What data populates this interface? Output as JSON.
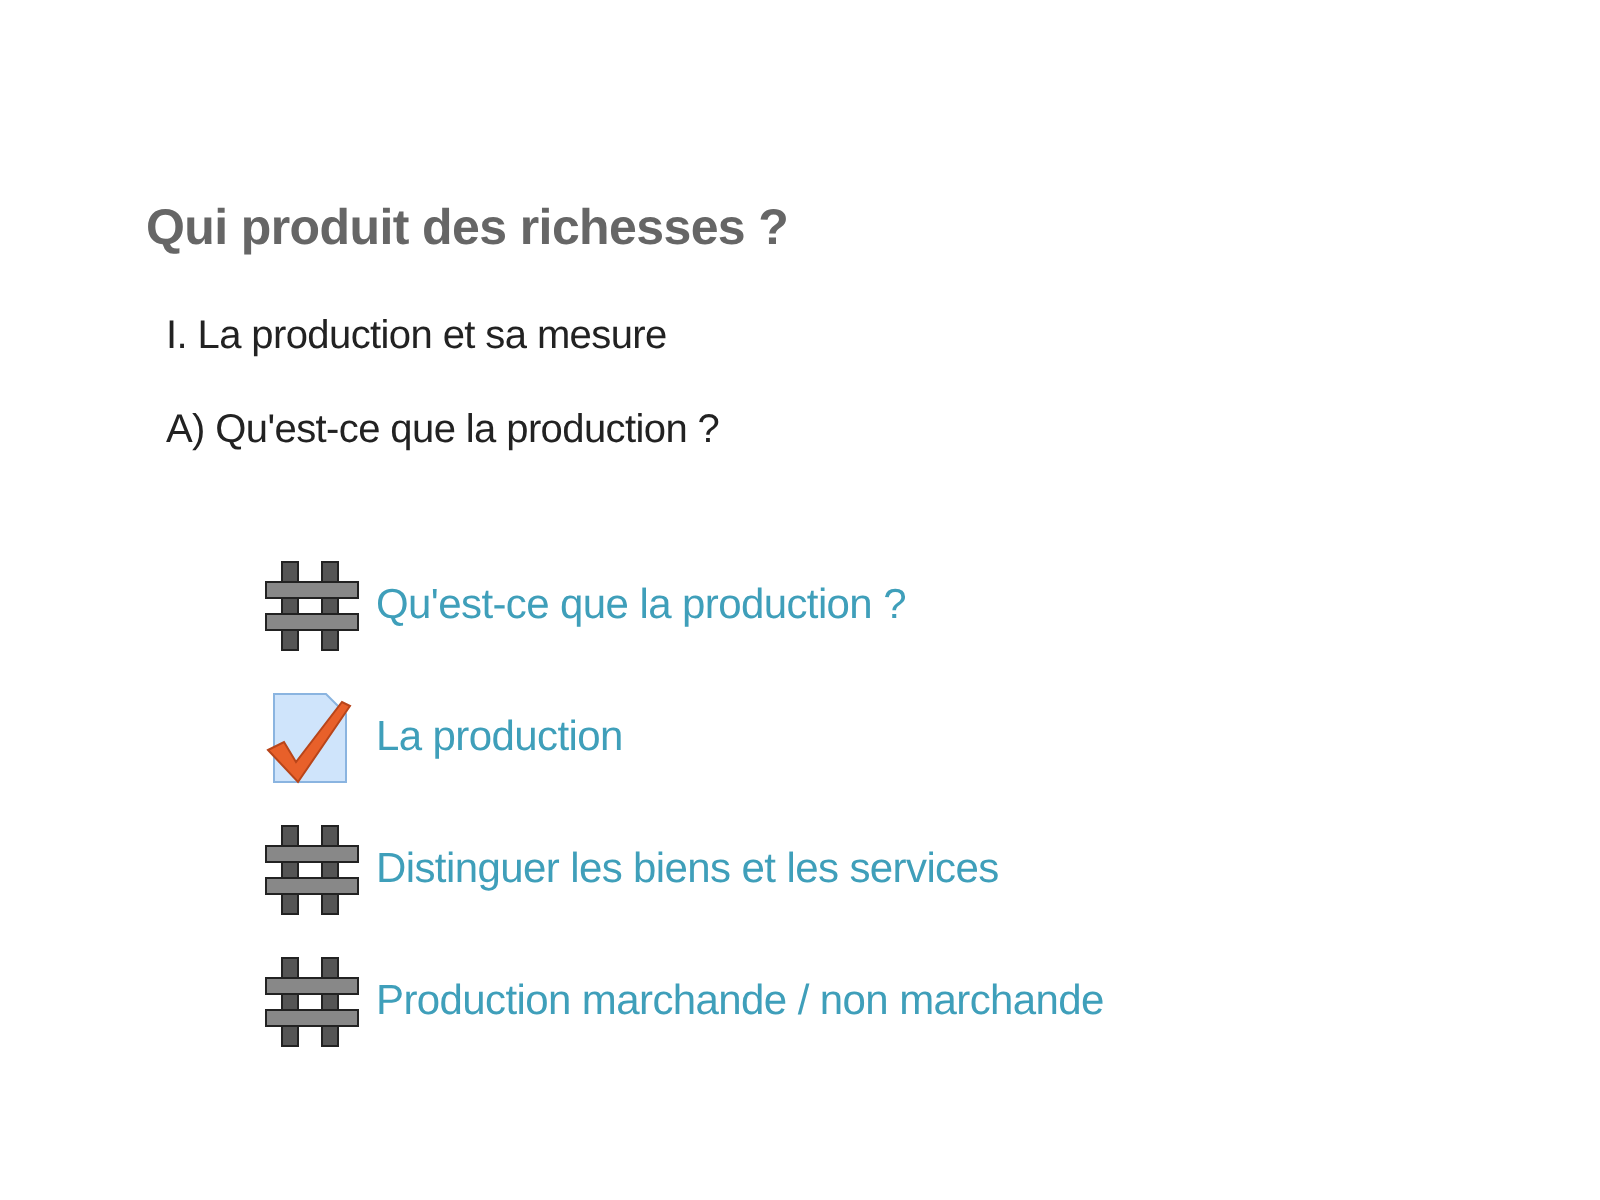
{
  "section": {
    "title": "Qui produit des richesses ?",
    "summary": [
      "I. La production et sa mesure",
      "A) Qu'est-ce que la production ?"
    ],
    "activities": [
      {
        "kind": "lattice",
        "label": "Qu'est-ce que la production ?"
      },
      {
        "kind": "assignment",
        "label": "La production"
      },
      {
        "kind": "lattice",
        "label": "Distinguer les biens et les services"
      },
      {
        "kind": "lattice",
        "label": "Production marchande / non marchande"
      }
    ]
  }
}
